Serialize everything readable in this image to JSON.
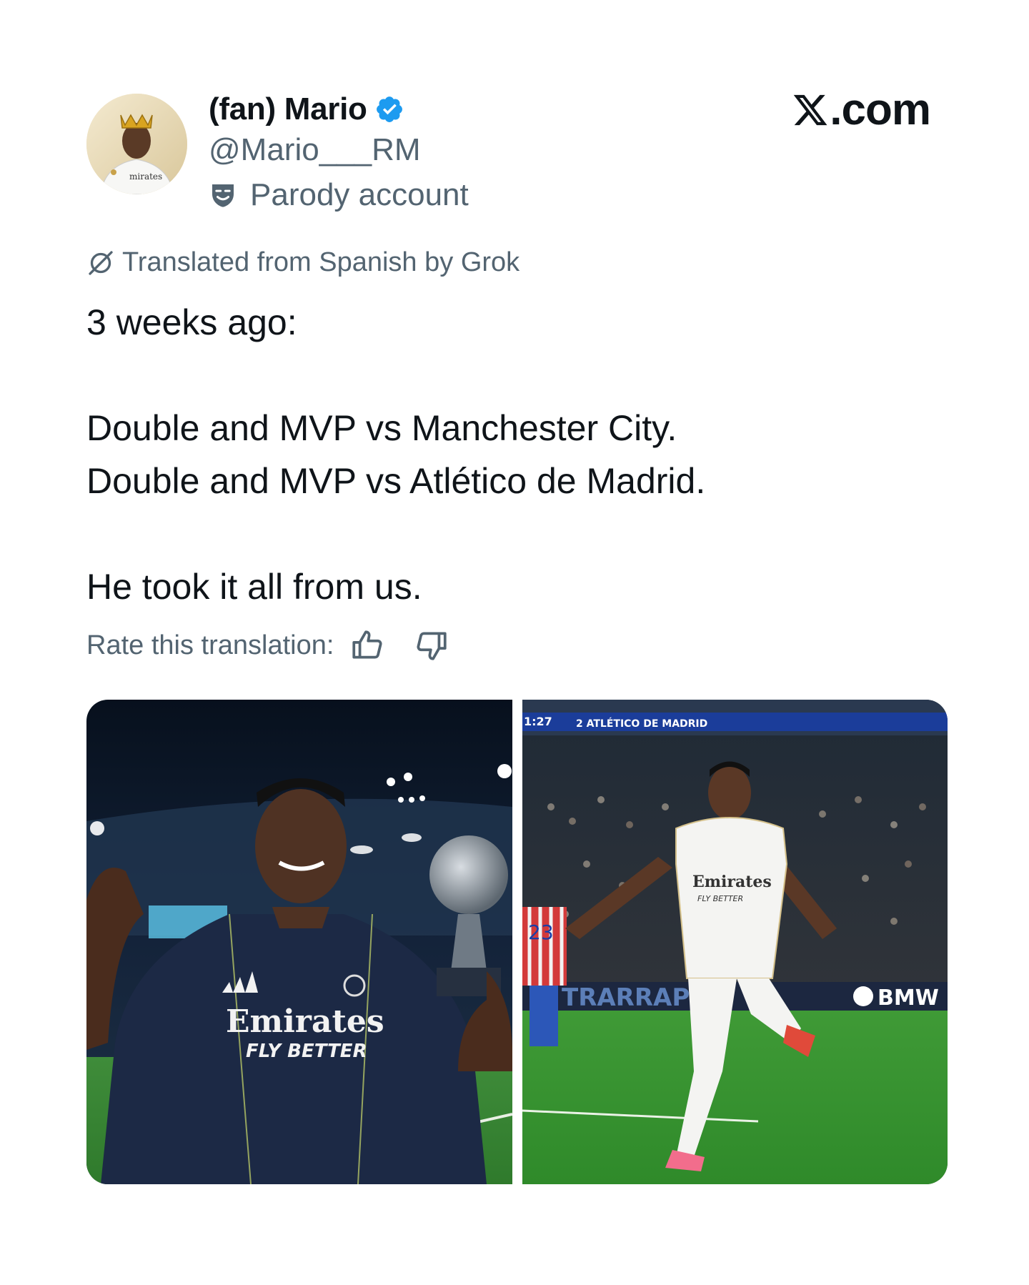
{
  "author": {
    "display_name": "(fan) Mario",
    "handle": "@Mario___RM",
    "verified": true,
    "label": "Parody account",
    "label_icon": "theater-mask-icon",
    "avatar_icon": "avatar"
  },
  "brand": {
    "logo_icon": "x-logo-icon",
    "text": ".com"
  },
  "tweet": {
    "translation_note": "Translated from Spanish by Grok",
    "lines": [
      "3 weeks ago:",
      "Double and MVP vs Manchester City.",
      "Double and MVP vs Atlético de Madrid.",
      "He took it all from us."
    ],
    "rate_label": "Rate this translation:",
    "rate_icons": [
      "thumbs-up-icon",
      "thumbs-down-icon"
    ]
  },
  "media": {
    "photos": [
      {
        "kind": "photo",
        "shirt_text_1": "Emirates",
        "shirt_text_2": "FLY BETTER"
      },
      {
        "kind": "photo",
        "scoreboard_time": "1:27",
        "scoreboard_text": "2 ATLÉTICO DE MADRID",
        "number": "23",
        "board_left": "TRARRAPI",
        "board_right": "BMW",
        "shirt_text_1": "Emirates",
        "shirt_text_2": "FLY BETTER"
      }
    ]
  },
  "colors": {
    "text_primary": "#0f1419",
    "text_secondary": "#536471",
    "verified_blue": "#1d9bf0"
  }
}
